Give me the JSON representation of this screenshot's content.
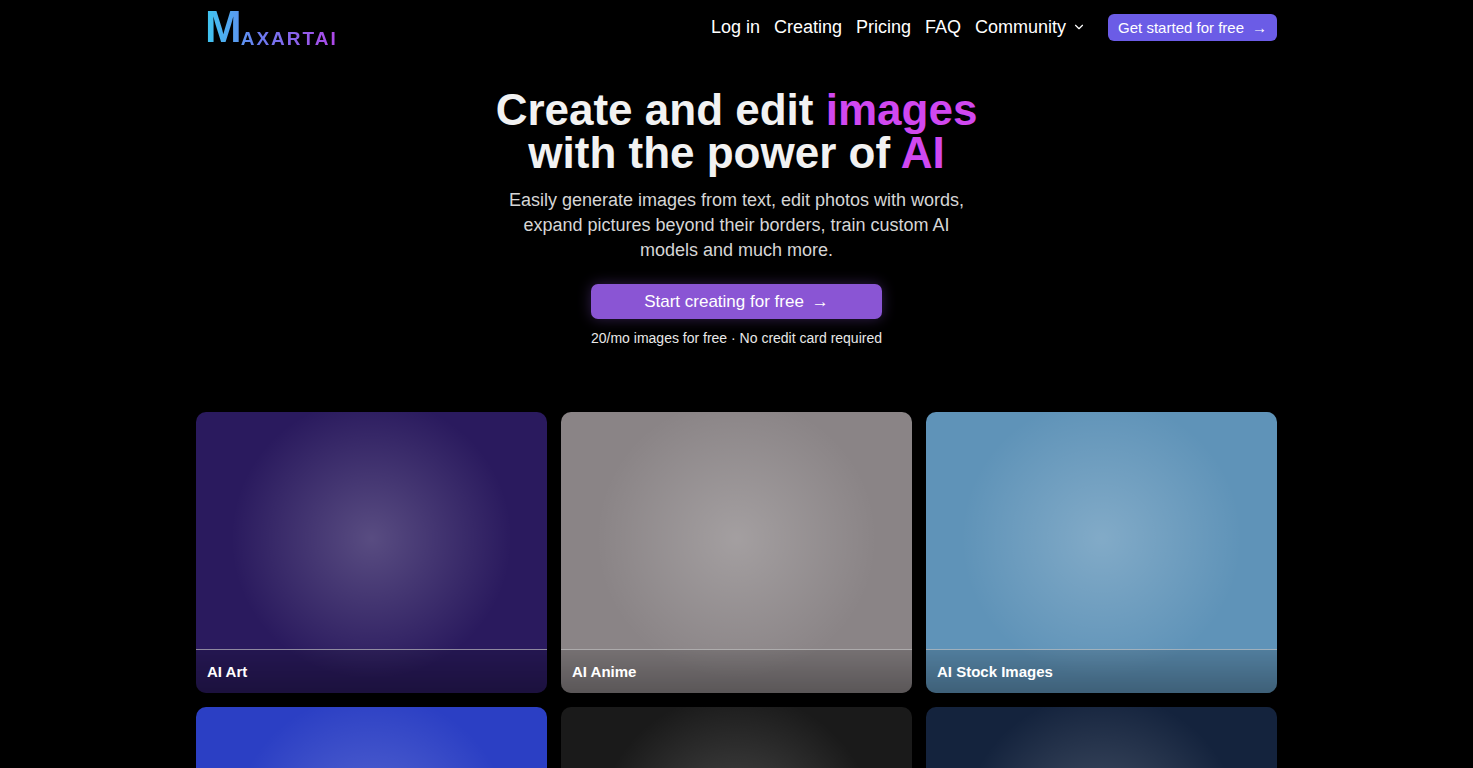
{
  "logo": {
    "initial": "M",
    "rest": "AXARTAI"
  },
  "nav": {
    "items": [
      "Log in",
      "Creating",
      "Pricing",
      "FAQ"
    ],
    "dropdown": "Community",
    "cta": {
      "label": "Get started for free",
      "arrow": "→"
    }
  },
  "hero": {
    "title_line1": "Create and edit ",
    "title_highlight1": "images",
    "title_line2": "with the power of ",
    "title_highlight2": "AI",
    "subtitle": "Easily generate images from text, edit photos with words, expand pictures beyond their borders, train custom AI models and much more.",
    "button": {
      "label": "Start creating for free",
      "arrow": "→"
    },
    "note": "20/mo images for free · No credit card required"
  },
  "cards": [
    {
      "label": "AI Art",
      "color": "#2a1a5e"
    },
    {
      "label": "AI Anime",
      "color": "#8a8486"
    },
    {
      "label": "AI Stock Images",
      "color": "#5f93b8"
    },
    {
      "label": "",
      "color": "#2b3fc4"
    },
    {
      "label": "",
      "color": "#1a1a1a"
    },
    {
      "label": "",
      "color": "#14233d"
    }
  ]
}
